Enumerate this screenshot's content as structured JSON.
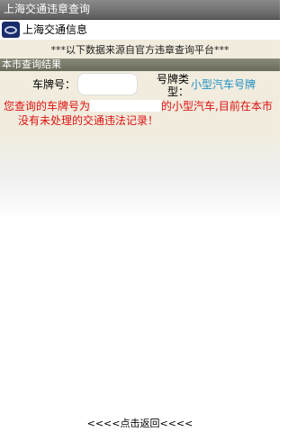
{
  "window": {
    "title": "上海交通违章查询"
  },
  "header": {
    "title": "上海交通信息"
  },
  "notice": "***以下数据来源自官方违章查询平台***",
  "section": {
    "title": "本市查询结果"
  },
  "form": {
    "plate_label": "车牌号：",
    "plate_value": "",
    "type_label_line1": "号牌类",
    "type_label_line2": "型：",
    "type_value": "小型汽车号牌"
  },
  "result": {
    "line1_prefix": "您查询的车牌号为",
    "line1_suffix": "的小型汽车,目前在本市",
    "line2": "没有未处理的交通违法记录！"
  },
  "footer": {
    "back_label": "<<<<点击返回<<<<"
  },
  "colors": {
    "title_bar": "#6f6f6f",
    "panel_bg": "#f1ecdd",
    "section_bar": "#7a7a6a",
    "result_text": "#dd1111",
    "type_value": "#1e90c8"
  }
}
